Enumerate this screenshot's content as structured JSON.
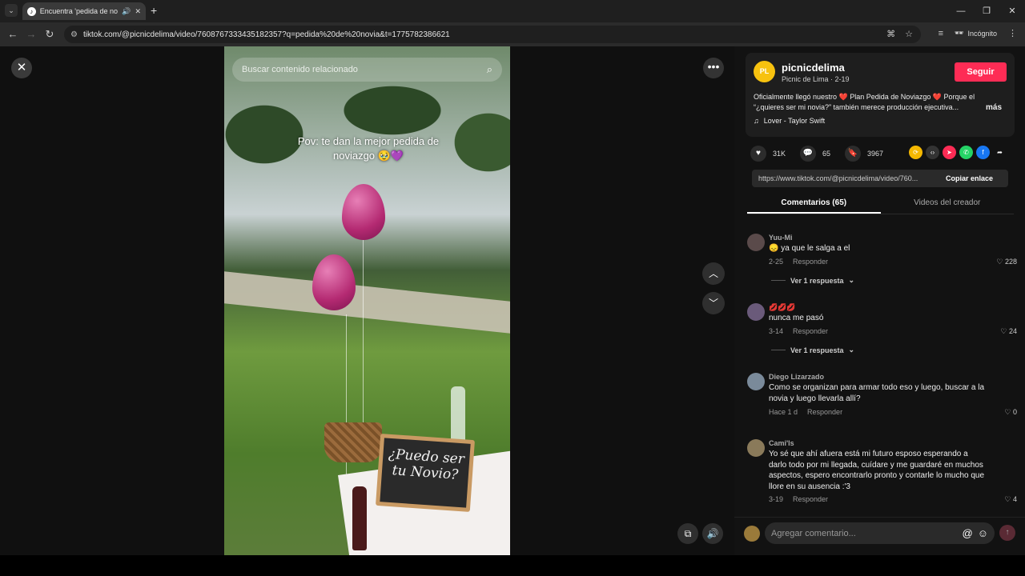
{
  "browser": {
    "tab_title": "Encuentra 'pedida de novia'",
    "url": "tiktok.com/@picnicdelima/video/7608767333435182357?q=pedida%20de%20novia&t=1775782386621",
    "incognito_label": "Incógnito"
  },
  "video": {
    "search_placeholder": "Buscar contenido relacionado",
    "overlay_caption": "Pov: te dan la mejor pedida de noviazgo 🥹💜",
    "sign_line1": "¿Puedo ser",
    "sign_line2": "tu Novio?"
  },
  "author": {
    "avatar_text": "PL",
    "username": "picnicdelima",
    "subline": "Picnic de Lima · 2-19",
    "follow_label": "Seguir",
    "caption": "Oficialmente llegó nuestro ❤️ Plan Pedida de Noviazgo ❤️ Porque el “¿quieres ser mi novia?” también merece producción ejecutiva...",
    "more_label": "más",
    "music": "Lover - Taylor Swift"
  },
  "stats": {
    "likes": "31K",
    "comments": "65",
    "saves": "3967"
  },
  "share": {
    "link": "https://www.tiktok.com/@picnicdelima/video/760...",
    "copy_label": "Copiar enlace"
  },
  "tabs": {
    "comments": "Comentarios (65)",
    "creator_videos": "Videos del creador"
  },
  "comments": [
    {
      "user": "Yuu-Mi",
      "text": "😞 ya que le salga a el",
      "date": "2-25",
      "reply": "Responder",
      "likes": "228",
      "replies_label": "Ver 1 respuesta",
      "avatar_color": "#5a4a4a"
    },
    {
      "user": "💋💋💋",
      "text": "nunca me pasó",
      "date": "3-14",
      "reply": "Responder",
      "likes": "24",
      "replies_label": "Ver 1 respuesta",
      "avatar_color": "#6a5a7a"
    },
    {
      "user": "Diego Lizarzado",
      "text": "Como se organizan para armar todo eso y luego, buscar a la novia y luego llevarla allí?",
      "date": "Hace 1 d",
      "reply": "Responder",
      "likes": "0",
      "avatar_color": "#7a8a9a"
    },
    {
      "user": "Cami'ls",
      "text": "Yo sé que ahí afuera está mi futuro esposo esperando a darlo todo por mi llegada, cuídare y me guardaré en muchos aspectos, espero encontrarlo pronto y contarle lo mucho que llore en su ausencia :'3",
      "date": "3-19",
      "reply": "Responder",
      "likes": "4",
      "avatar_color": "#8a7a5a"
    }
  ],
  "comment_input": {
    "placeholder": "Agregar comentario..."
  },
  "colors": {
    "accent": "#fe2c55",
    "panel_bg": "#121212"
  }
}
